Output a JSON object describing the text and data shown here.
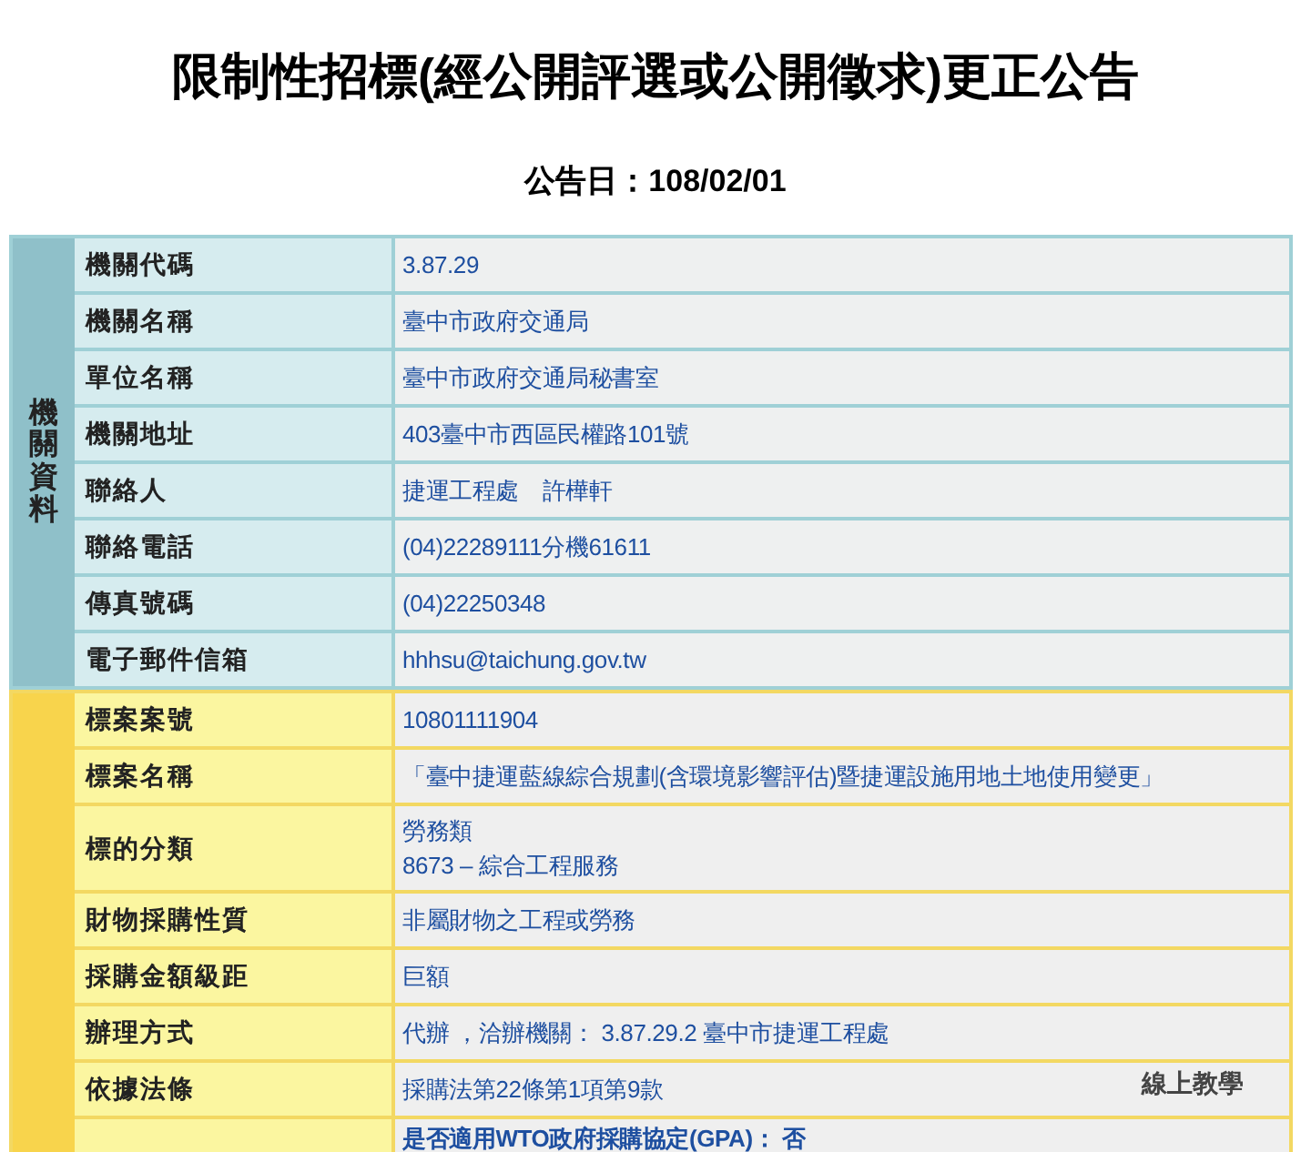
{
  "title": "限制性招標(經公開評選或公開徵求)更正公告",
  "announce_date": "公告日：108/02/01",
  "sections": [
    {
      "kind": "agency",
      "group_label": "機關資料",
      "rows": [
        {
          "label": "機關代碼",
          "lines": [
            "3.87.29"
          ]
        },
        {
          "label": "機關名稱",
          "lines": [
            "臺中市政府交通局"
          ]
        },
        {
          "label": "單位名稱",
          "lines": [
            "臺中市政府交通局秘書室"
          ]
        },
        {
          "label": "機關地址",
          "lines": [
            "403臺中市西區民權路101號"
          ]
        },
        {
          "label": "聯絡人",
          "lines": [
            "捷運工程處　許樺軒"
          ]
        },
        {
          "label": "聯絡電話",
          "lines": [
            "(04)22289111分機61611"
          ]
        },
        {
          "label": "傳真號碼",
          "lines": [
            "(04)22250348"
          ]
        },
        {
          "label": "電子郵件信箱",
          "lines": [
            "hhhsu@taichung.gov.tw"
          ]
        }
      ]
    },
    {
      "kind": "tender",
      "rows": [
        {
          "label": "標案案號",
          "lines": [
            "10801111904"
          ]
        },
        {
          "label": "標案名稱",
          "lines": [
            "「臺中捷運藍線綜合規劃(含環境影響評估)暨捷運設施用地土地使用變更」"
          ]
        },
        {
          "label": "標的分類",
          "lines": [
            "勞務類",
            "8673 – 綜合工程服務"
          ]
        },
        {
          "label": "財物採購性質",
          "lines": [
            "非屬財物之工程或勞務"
          ]
        },
        {
          "label": "採購金額級距",
          "lines": [
            "巨額"
          ]
        },
        {
          "label": "辦理方式",
          "lines": [
            "代辦 ，洽辦機關： 3.87.29.2 臺中市捷運工程處"
          ]
        },
        {
          "label": "依據法條",
          "lines": [
            "採購法第22條第1項第9款"
          ]
        },
        {
          "lines": [
            "是否適用WTO政府採購協定(GPA)： 否"
          ],
          "bold": true
        }
      ]
    }
  ],
  "floating_link": "線上教學"
}
